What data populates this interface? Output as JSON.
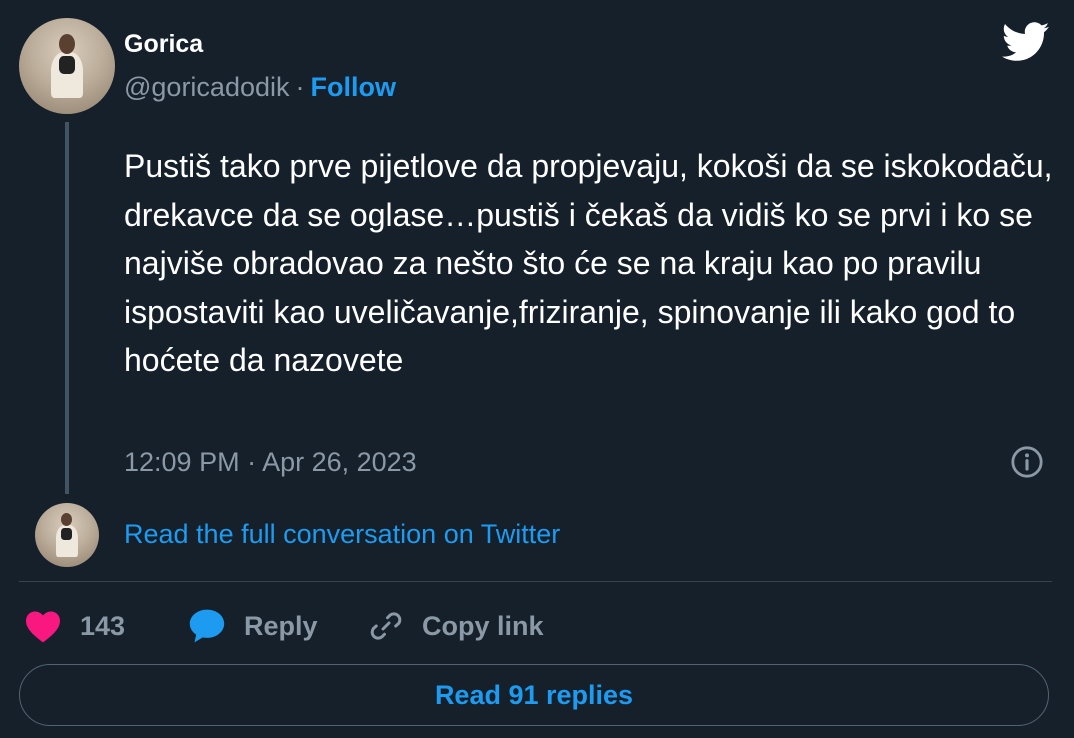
{
  "author": {
    "name": "Gorica",
    "handle": "@goricadodik",
    "separator": "·",
    "follow_label": "Follow"
  },
  "tweet": {
    "text": "Pustiš tako prve pijetlove da propjevaju, kokoši da se iskokodaču, drekavce da se oglase…pustiš i čekaš da vidiš ko se prvi i ko se najviše obradovao za nešto što će se na kraju kao po pravilu ispostaviti kao uveličavanje,friziranje, spinovanje ili kako god to hoćete da nazovete",
    "timestamp": "12:09 PM · Apr 26, 2023"
  },
  "conversation_link": "Read the full conversation on Twitter",
  "actions": {
    "like_count": "143",
    "reply_label": "Reply",
    "copy_label": "Copy link"
  },
  "replies_button": "Read 91 replies",
  "icons": {
    "logo": "twitter-bird-icon",
    "info": "info-icon",
    "like": "heart-icon",
    "reply": "speech-bubble-icon",
    "copy": "link-icon"
  },
  "colors": {
    "background": "#15202b",
    "accent": "#1d9bf0",
    "secondary_text": "#8b98a5",
    "like": "#f91880"
  }
}
